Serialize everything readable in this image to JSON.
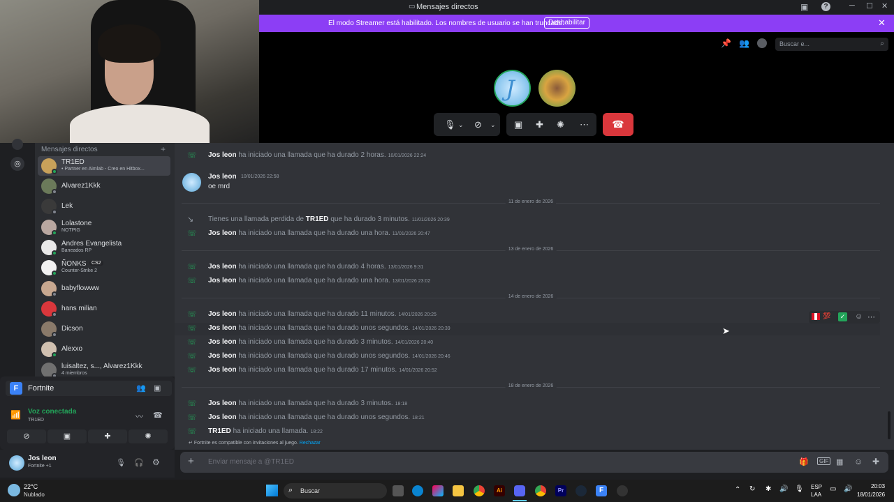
{
  "window": {
    "title": "Mensajes directos",
    "controls": [
      "─",
      "☐",
      "✕"
    ]
  },
  "streamer_banner": {
    "message": "El modo Streamer está habilitado. Los nombres de usuario se han truncado.",
    "button": "Deshabilitar"
  },
  "header": {
    "search_placeholder": "Buscar e..."
  },
  "call": {
    "participant_initial": "J"
  },
  "sidebar": {
    "section_title": "Mensajes directos",
    "dms": [
      {
        "name": "TR1ED",
        "sub": "• Partner en Aimlab - Creo en Hitbox...",
        "selected": true,
        "color": "#c8a15a",
        "status": "#23a55a"
      },
      {
        "name": "Alvarez1Kkk",
        "sub": "",
        "color": "#6b7a5a",
        "status": "#80848e"
      },
      {
        "name": "Lek",
        "sub": "",
        "color": "#3a3a3a",
        "status": "#80848e"
      },
      {
        "name": "Lolastone",
        "sub": "NOTPIG",
        "color": "#b9a7a0",
        "status": "#23a55a"
      },
      {
        "name": "Andres Evangelista",
        "sub": "Baneados RP",
        "color": "#e9e9e9",
        "status": "#23a55a"
      },
      {
        "name": "ÑONKS",
        "sub": "Counter-Strike 2",
        "badge": "CS2",
        "color": "#f2f2f2",
        "status": "#23a55a"
      },
      {
        "name": "babyflowww",
        "sub": "",
        "color": "#c8a890",
        "status": "#80848e"
      },
      {
        "name": "hans milian",
        "sub": "",
        "color": "#da373c",
        "status": "#80848e"
      },
      {
        "name": "Dicson",
        "sub": "",
        "color": "#8a7a6a",
        "status": "#80848e"
      },
      {
        "name": "Alexxo",
        "sub": "",
        "color": "#d0c0b0",
        "status": "#23a55a"
      },
      {
        "name": "luisaltez, s..., Alvarez1Kkk",
        "sub": "4 miembros",
        "color": "#707070",
        "status": "#80848e"
      }
    ]
  },
  "voice": {
    "game": "Fortnite",
    "status": "Voz conectada",
    "channel": "TR1ED"
  },
  "user": {
    "name": "Jos leon",
    "activity": "Fortnite +1"
  },
  "chat": {
    "messages": [
      {
        "type": "call",
        "who": "Jos leon",
        "text": "ha iniciado una llamada que ha durado 2 horas.",
        "ts": "10/01/2026 22:24"
      },
      {
        "type": "message",
        "who": "Jos leon",
        "ts": "10/01/2026 22:58",
        "text": "oe mrd"
      },
      {
        "type": "divider",
        "text": "11 de enero de 2026"
      },
      {
        "type": "missed",
        "pre": "Tienes una llamada perdida de",
        "who": "TR1ED",
        "text": "que ha durado 3 minutos.",
        "ts": "11/01/2026 20:39"
      },
      {
        "type": "call",
        "who": "Jos leon",
        "text": "ha iniciado una llamada que ha durado una hora.",
        "ts": "11/01/2026 20:47"
      },
      {
        "type": "divider",
        "text": "13 de enero de 2026"
      },
      {
        "type": "call",
        "who": "Jos leon",
        "text": "ha iniciado una llamada que ha durado 4 horas.",
        "ts": "13/01/2026 9:31"
      },
      {
        "type": "call",
        "who": "Jos leon",
        "text": "ha iniciado una llamada que ha durado una hora.",
        "ts": "13/01/2026 23:02"
      },
      {
        "type": "divider",
        "text": "14 de enero de 2026"
      },
      {
        "type": "call",
        "who": "Jos leon",
        "text": "ha iniciado una llamada que ha durado 11 minutos.",
        "ts": "14/01/2026 20:25"
      },
      {
        "type": "call",
        "who": "Jos leon",
        "text": "ha iniciado una llamada que ha durado unos segundos.",
        "ts": "14/01/2026 20:39",
        "hover": true
      },
      {
        "type": "call",
        "who": "Jos leon",
        "text": "ha iniciado una llamada que ha durado 3 minutos.",
        "ts": "14/01/2026 20:40"
      },
      {
        "type": "call",
        "who": "Jos leon",
        "text": "ha iniciado una llamada que ha durado unos segundos.",
        "ts": "14/01/2026 20:46"
      },
      {
        "type": "call",
        "who": "Jos leon",
        "text": "ha iniciado una llamada que ha durado 17 minutos.",
        "ts": "14/01/2026 20:52"
      },
      {
        "type": "divider",
        "text": "18 de enero de 2026"
      },
      {
        "type": "call",
        "who": "Jos leon",
        "text": "ha iniciado una llamada que ha durado 3 minutos.",
        "ts": "18:18"
      },
      {
        "type": "call",
        "who": "Jos leon",
        "text": "ha iniciado una llamada que ha durado unos segundos.",
        "ts": "18:21"
      },
      {
        "type": "call",
        "who": "TR1ED",
        "text": "ha iniciado una llamada.",
        "ts": "18:22"
      }
    ],
    "game_invite": {
      "text": "Fortnite es compatible con invitaciones al juego.",
      "link": "Rechazar"
    },
    "input_placeholder": "Enviar mensaje a @TR1ED"
  },
  "taskbar": {
    "weather_temp": "22°C",
    "weather_desc": "Nublado",
    "search": "Buscar",
    "lang": "ESP",
    "lang2": "LAA",
    "time": "20:03",
    "date": "18/01/2026"
  }
}
